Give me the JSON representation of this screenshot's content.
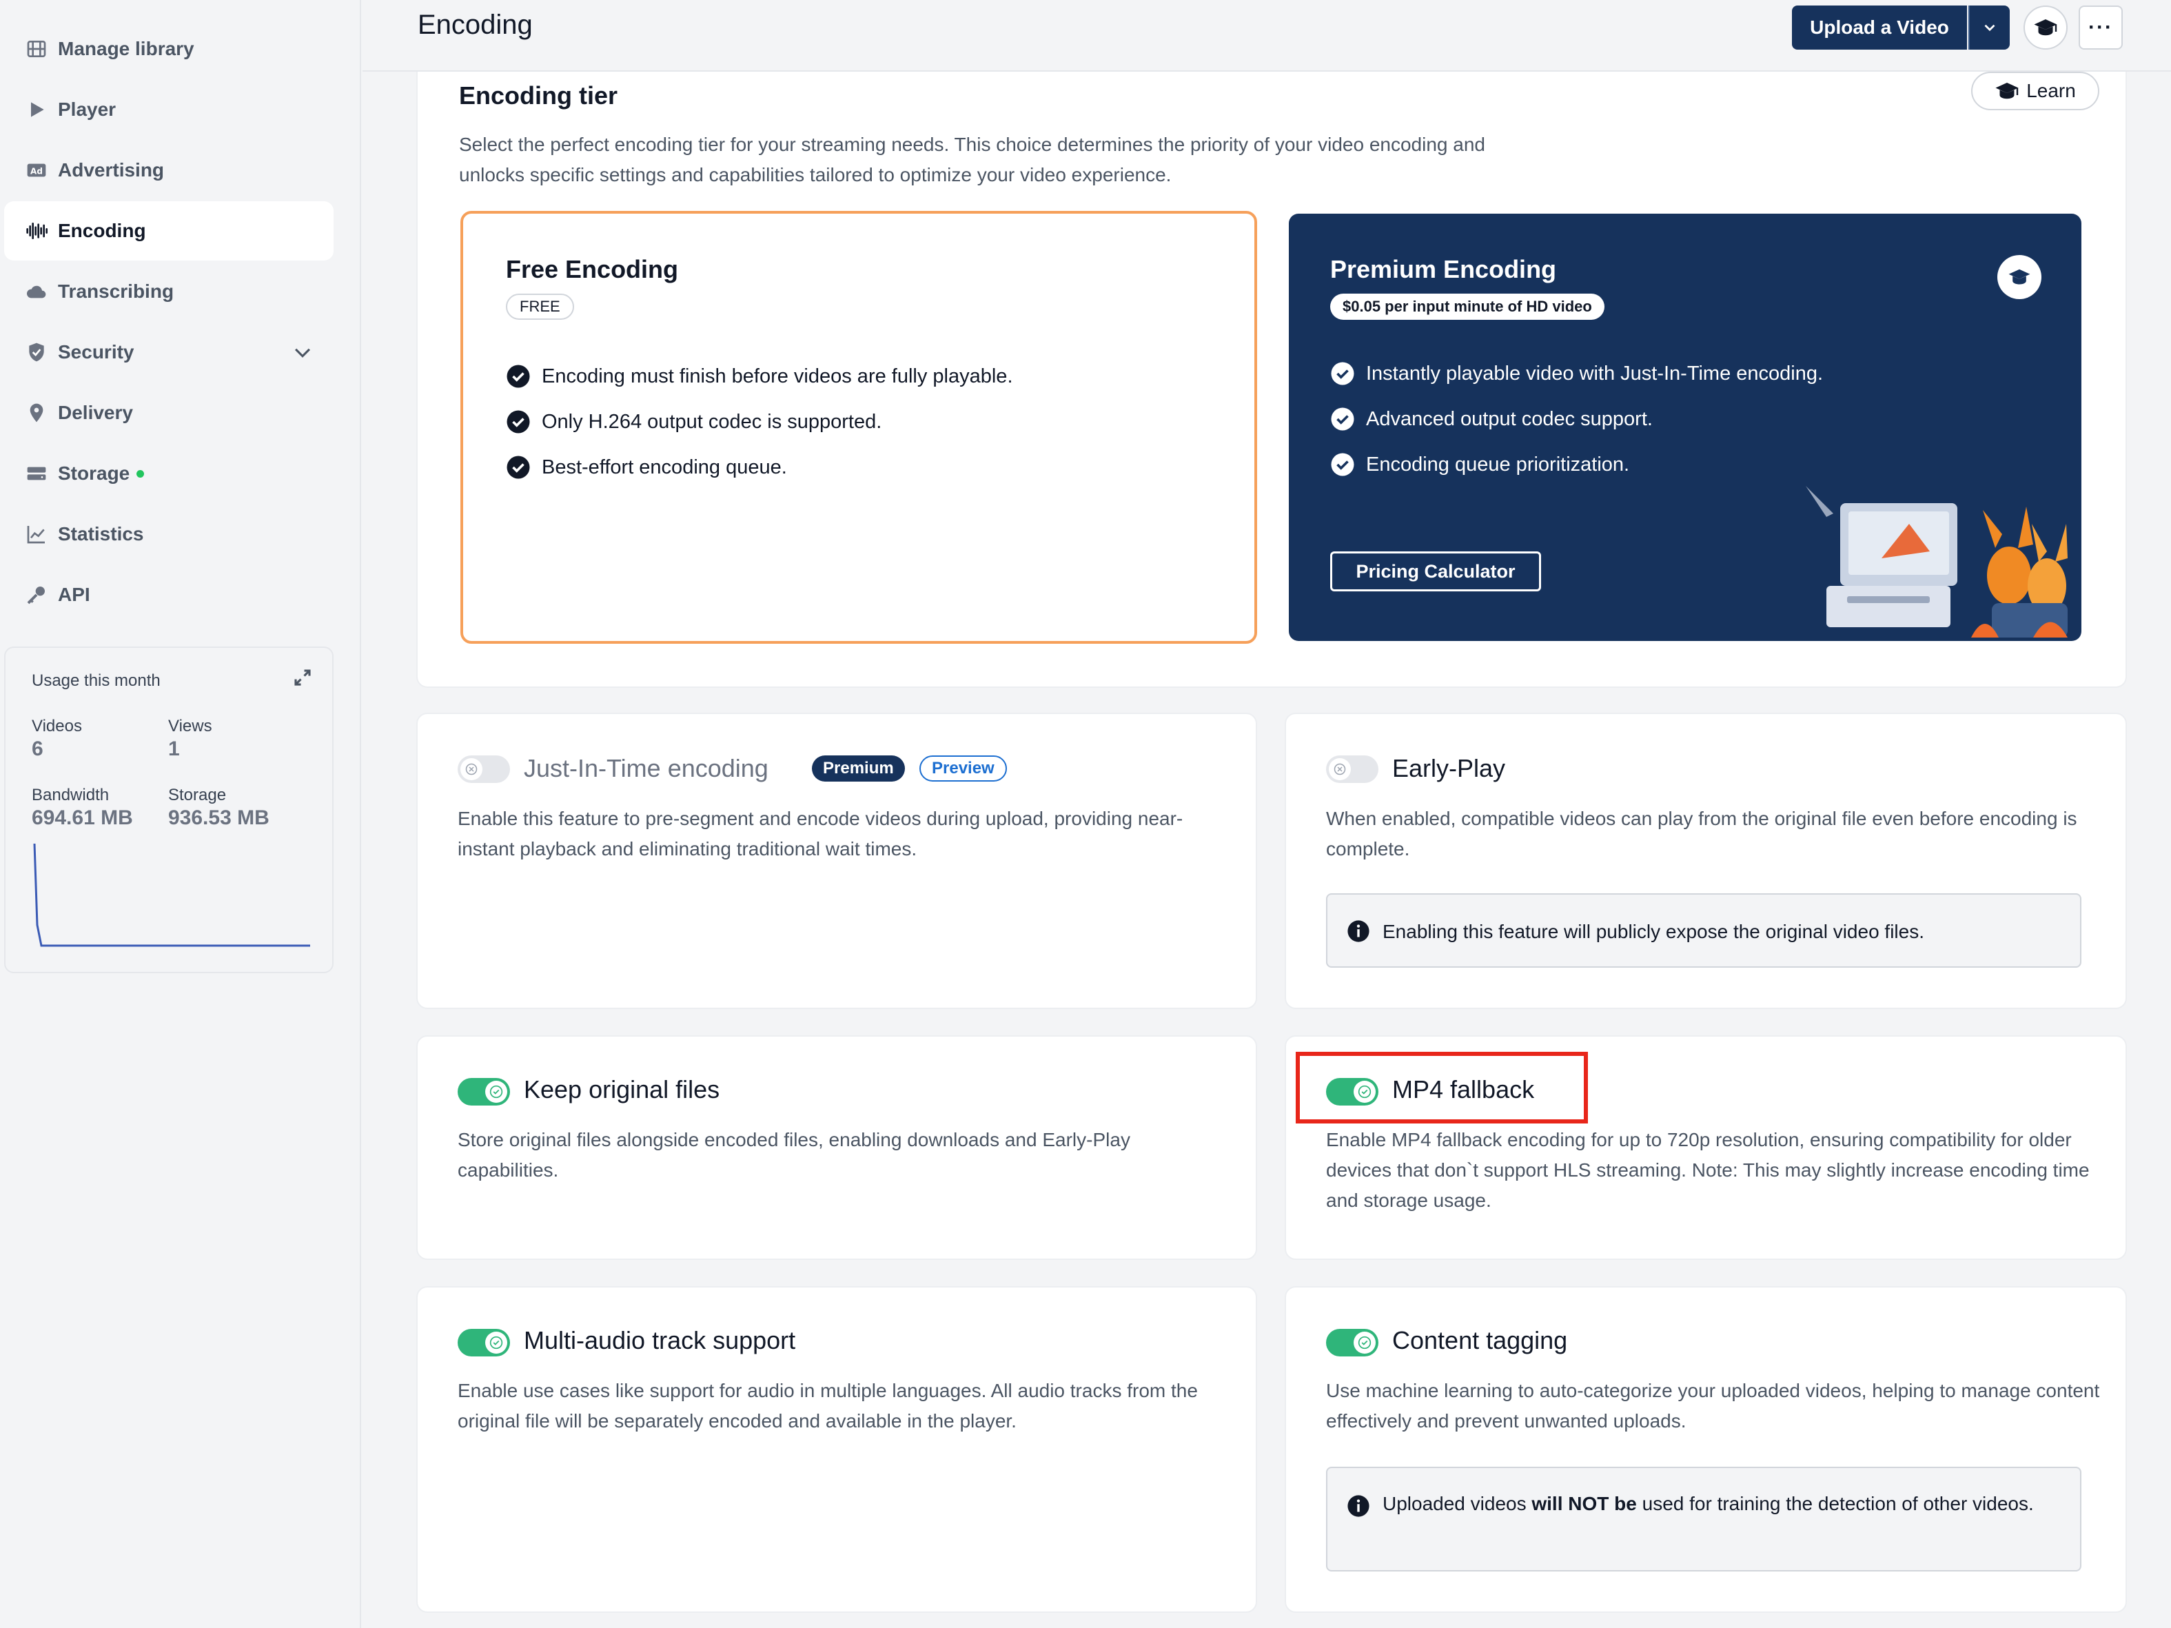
{
  "sidebar": {
    "items": [
      {
        "label": "Manage library",
        "icon": "film-icon"
      },
      {
        "label": "Player",
        "icon": "play-icon"
      },
      {
        "label": "Advertising",
        "icon": "ad-icon"
      },
      {
        "label": "Encoding",
        "icon": "waveform-icon"
      },
      {
        "label": "Transcribing",
        "icon": "cloud-icon"
      },
      {
        "label": "Security",
        "icon": "shield-icon"
      },
      {
        "label": "Delivery",
        "icon": "map-pin-icon"
      },
      {
        "label": "Storage",
        "icon": "storage-icon"
      },
      {
        "label": "Statistics",
        "icon": "chart-icon"
      },
      {
        "label": "API",
        "icon": "key-icon"
      }
    ],
    "usage": {
      "title": "Usage this month",
      "videos_label": "Videos",
      "videos_value": "6",
      "views_label": "Views",
      "views_value": "1",
      "bandwidth_label": "Bandwidth",
      "bandwidth_value": "694.61 MB",
      "storage_label": "Storage",
      "storage_value": "936.53 MB"
    }
  },
  "header": {
    "title": "Encoding",
    "upload_label": "Upload a Video",
    "more_label": "···"
  },
  "tier": {
    "title": "Encoding tier",
    "description": "Select the perfect encoding tier for your streaming needs. This choice determines the priority of your video encoding and unlocks specific settings and capabilities tailored to optimize your video experience.",
    "learn_label": "Learn",
    "free": {
      "title": "Free Encoding",
      "tag": "FREE",
      "features": [
        "Encoding must finish before videos are fully playable.",
        "Only H.264 output codec is supported.",
        "Best-effort encoding queue."
      ]
    },
    "premium": {
      "title": "Premium Encoding",
      "tag": "$0.05 per input minute of HD video",
      "features": [
        "Instantly playable video with Just-In-Time encoding.",
        "Advanced output codec support.",
        "Encoding queue prioritization."
      ],
      "pricing_label": "Pricing Calculator"
    }
  },
  "features": {
    "jit": {
      "title": "Just-In-Time encoding",
      "badge_premium": "Premium",
      "badge_preview": "Preview",
      "description": "Enable this feature to pre-segment and encode videos during upload, providing near-instant playback and eliminating traditional wait times.",
      "enabled": false
    },
    "early_play": {
      "title": "Early-Play",
      "description": "When enabled, compatible videos can play from the original file even before encoding is complete.",
      "info": "Enabling this feature will publicly expose the original video files.",
      "enabled": false
    },
    "keep_original": {
      "title": "Keep original files",
      "description": "Store original files alongside encoded files, enabling downloads and Early-Play capabilities.",
      "enabled": true
    },
    "mp4_fallback": {
      "title": "MP4 fallback",
      "description": "Enable MP4 fallback encoding for up to 720p resolution, ensuring compatibility for older devices that don`t support HLS streaming. Note: This may slightly increase encoding time and storage usage.",
      "enabled": true
    },
    "multi_audio": {
      "title": "Multi-audio track support",
      "description": "Enable use cases like support for audio in multiple languages. All audio tracks from the original file will be separately encoded and available in the player.",
      "enabled": true
    },
    "content_tagging": {
      "title": "Content tagging",
      "description": "Use machine learning to auto-categorize your uploaded videos, helping to manage content effectively and prevent unwanted uploads.",
      "info_pre": "Uploaded videos ",
      "info_bold": "will NOT be",
      "info_post": " used for training the detection of other videos.",
      "enabled": true
    }
  },
  "colors": {
    "navy": "#16325c",
    "toggle_on": "#2fb57a",
    "free_border": "#f6a05a",
    "highlight": "#e8261a"
  }
}
